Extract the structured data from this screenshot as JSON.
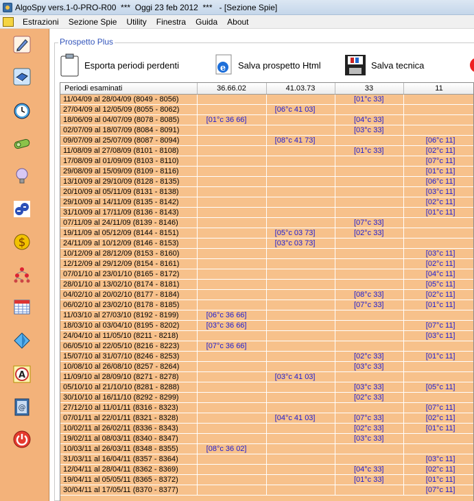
{
  "window": {
    "title": "AlgoSpy vers.1-0-PRO-R00  ***  Oggi 23 feb 2012  ***   - [Sezione Spie]"
  },
  "menu": {
    "items": [
      "Estrazioni",
      "Sezione Spie",
      "Utility",
      "Finestra",
      "Guida",
      "About"
    ]
  },
  "sidebar": {
    "icons": [
      "pencil-icon",
      "book-icon",
      "clock-icon",
      "money-roll-icon",
      "lightbulb-icon",
      "lottery-balls-icon",
      "dollar-icon",
      "hierarchy-icon",
      "calendar-icon",
      "diamond-icon",
      "letter-a-icon",
      "address-book-icon",
      "power-icon"
    ]
  },
  "panel": {
    "title": "Prospetto Plus"
  },
  "toolbar": {
    "export_label": "Esporta periodi perdenti",
    "save_html_label": "Salva prospetto Html",
    "save_tech_label": "Salva tecnica"
  },
  "table": {
    "headers": [
      "Periodi esaminati",
      "36.66.02",
      "41.03.73",
      "33",
      "11"
    ],
    "rows": [
      [
        "11/04/09 al 28/04/09  (8049 - 8056)",
        "",
        "",
        "[01°c 33]",
        ""
      ],
      [
        "27/04/09 al 12/05/09  (8055 - 8062)",
        "",
        "[06°c 41 03]",
        "",
        ""
      ],
      [
        "18/06/09 al 04/07/09  (8078 - 8085)",
        "[01°c 36 66]",
        "",
        "[04°c 33]",
        ""
      ],
      [
        "02/07/09 al 18/07/09  (8084 - 8091)",
        "",
        "",
        "[03°c 33]",
        ""
      ],
      [
        "09/07/09 al 25/07/09  (8087 - 8094)",
        "",
        "[08°c 41 73]",
        "",
        "[06°c 11]"
      ],
      [
        "11/08/09 al 27/08/09  (8101 - 8108)",
        "",
        "",
        "[01°c 33]",
        "[02°c 11]"
      ],
      [
        "17/08/09 al 01/09/09  (8103 - 8110)",
        "",
        "",
        "",
        "[07°c 11]"
      ],
      [
        "29/08/09 al 15/09/09  (8109 - 8116)",
        "",
        "",
        "",
        "[01°c 11]"
      ],
      [
        "13/10/09 al 29/10/09  (8128 - 8135)",
        "",
        "",
        "",
        "[06°c 11]"
      ],
      [
        "20/10/09 al 05/11/09  (8131 - 8138)",
        "",
        "",
        "",
        "[03°c 11]"
      ],
      [
        "29/10/09 al 14/11/09  (8135 - 8142)",
        "",
        "",
        "",
        "[02°c 11]"
      ],
      [
        "31/10/09 al 17/11/09  (8136 - 8143)",
        "",
        "",
        "",
        "[01°c 11]"
      ],
      [
        "07/11/09 al 24/11/09  (8139 - 8146)",
        "",
        "",
        "[07°c 33]",
        ""
      ],
      [
        "19/11/09 al 05/12/09  (8144 - 8151)",
        "",
        "[05°c 03 73]",
        "[02°c 33]",
        ""
      ],
      [
        "24/11/09 al 10/12/09  (8146 - 8153)",
        "",
        "[03°c 03 73]",
        "",
        ""
      ],
      [
        "10/12/09 al 28/12/09  (8153 - 8160)",
        "",
        "",
        "",
        "[03°c 11]"
      ],
      [
        "12/12/09 al 29/12/09  (8154 - 8161)",
        "",
        "",
        "",
        "[02°c 11]"
      ],
      [
        "07/01/10 al 23/01/10  (8165 - 8172)",
        "",
        "",
        "",
        "[04°c 11]"
      ],
      [
        "28/01/10 al 13/02/10  (8174 - 8181)",
        "",
        "",
        "",
        "[05°c 11]"
      ],
      [
        "04/02/10 al 20/02/10  (8177 - 8184)",
        "",
        "",
        "[08°c 33]",
        "[02°c 11]"
      ],
      [
        "06/02/10 al 23/02/10  (8178 - 8185)",
        "",
        "",
        "[07°c 33]",
        "[01°c 11]"
      ],
      [
        "11/03/10 al 27/03/10  (8192 - 8199)",
        "[06°c 36 66]",
        "",
        "",
        ""
      ],
      [
        "18/03/10 al 03/04/10  (8195 - 8202)",
        "[03°c 36 66]",
        "",
        "",
        "[07°c 11]"
      ],
      [
        "24/04/10 al 11/05/10  (8211 - 8218)",
        "",
        "",
        "",
        "[03°c 11]"
      ],
      [
        "06/05/10 al 22/05/10  (8216 - 8223)",
        "[07°c 36 66]",
        "",
        "",
        ""
      ],
      [
        "15/07/10 al 31/07/10  (8246 - 8253)",
        "",
        "",
        "[02°c 33]",
        "[01°c 11]"
      ],
      [
        "10/08/10 al 26/08/10  (8257 - 8264)",
        "",
        "",
        "[03°c 33]",
        ""
      ],
      [
        "11/09/10 al 28/09/10  (8271 - 8278)",
        "",
        "[03°c 41 03]",
        "",
        ""
      ],
      [
        "05/10/10 al 21/10/10  (8281 - 8288)",
        "",
        "",
        "[03°c 33]",
        "[05°c 11]"
      ],
      [
        "30/10/10 al 16/11/10  (8292 - 8299)",
        "",
        "",
        "[02°c 33]",
        ""
      ],
      [
        "27/12/10 al 11/01/11  (8316 - 8323)",
        "",
        "",
        "",
        "[07°c 11]"
      ],
      [
        "07/01/11 al 22/01/11  (8321 - 8328)",
        "",
        "[04°c 41 03]",
        "[07°c 33]",
        "[02°c 11]"
      ],
      [
        "10/02/11 al 26/02/11  (8336 - 8343)",
        "",
        "",
        "[02°c 33]",
        "[01°c 11]"
      ],
      [
        "19/02/11 al 08/03/11  (8340 - 8347)",
        "",
        "",
        "[03°c 33]",
        ""
      ],
      [
        "10/03/11 al 26/03/11  (8348 - 8355)",
        "[08°c 36 02]",
        "",
        "",
        ""
      ],
      [
        "31/03/11 al 16/04/11  (8357 - 8364)",
        "",
        "",
        "",
        "[03°c 11]"
      ],
      [
        "12/04/11 al 28/04/11  (8362 - 8369)",
        "",
        "",
        "[04°c 33]",
        "[02°c 11]"
      ],
      [
        "19/04/11 al 05/05/11  (8365 - 8372)",
        "",
        "",
        "[01°c 33]",
        "[01°c 11]"
      ],
      [
        "30/04/11 al 17/05/11  (8370 - 8377)",
        "",
        "",
        "",
        "[07°c 11]"
      ]
    ]
  }
}
